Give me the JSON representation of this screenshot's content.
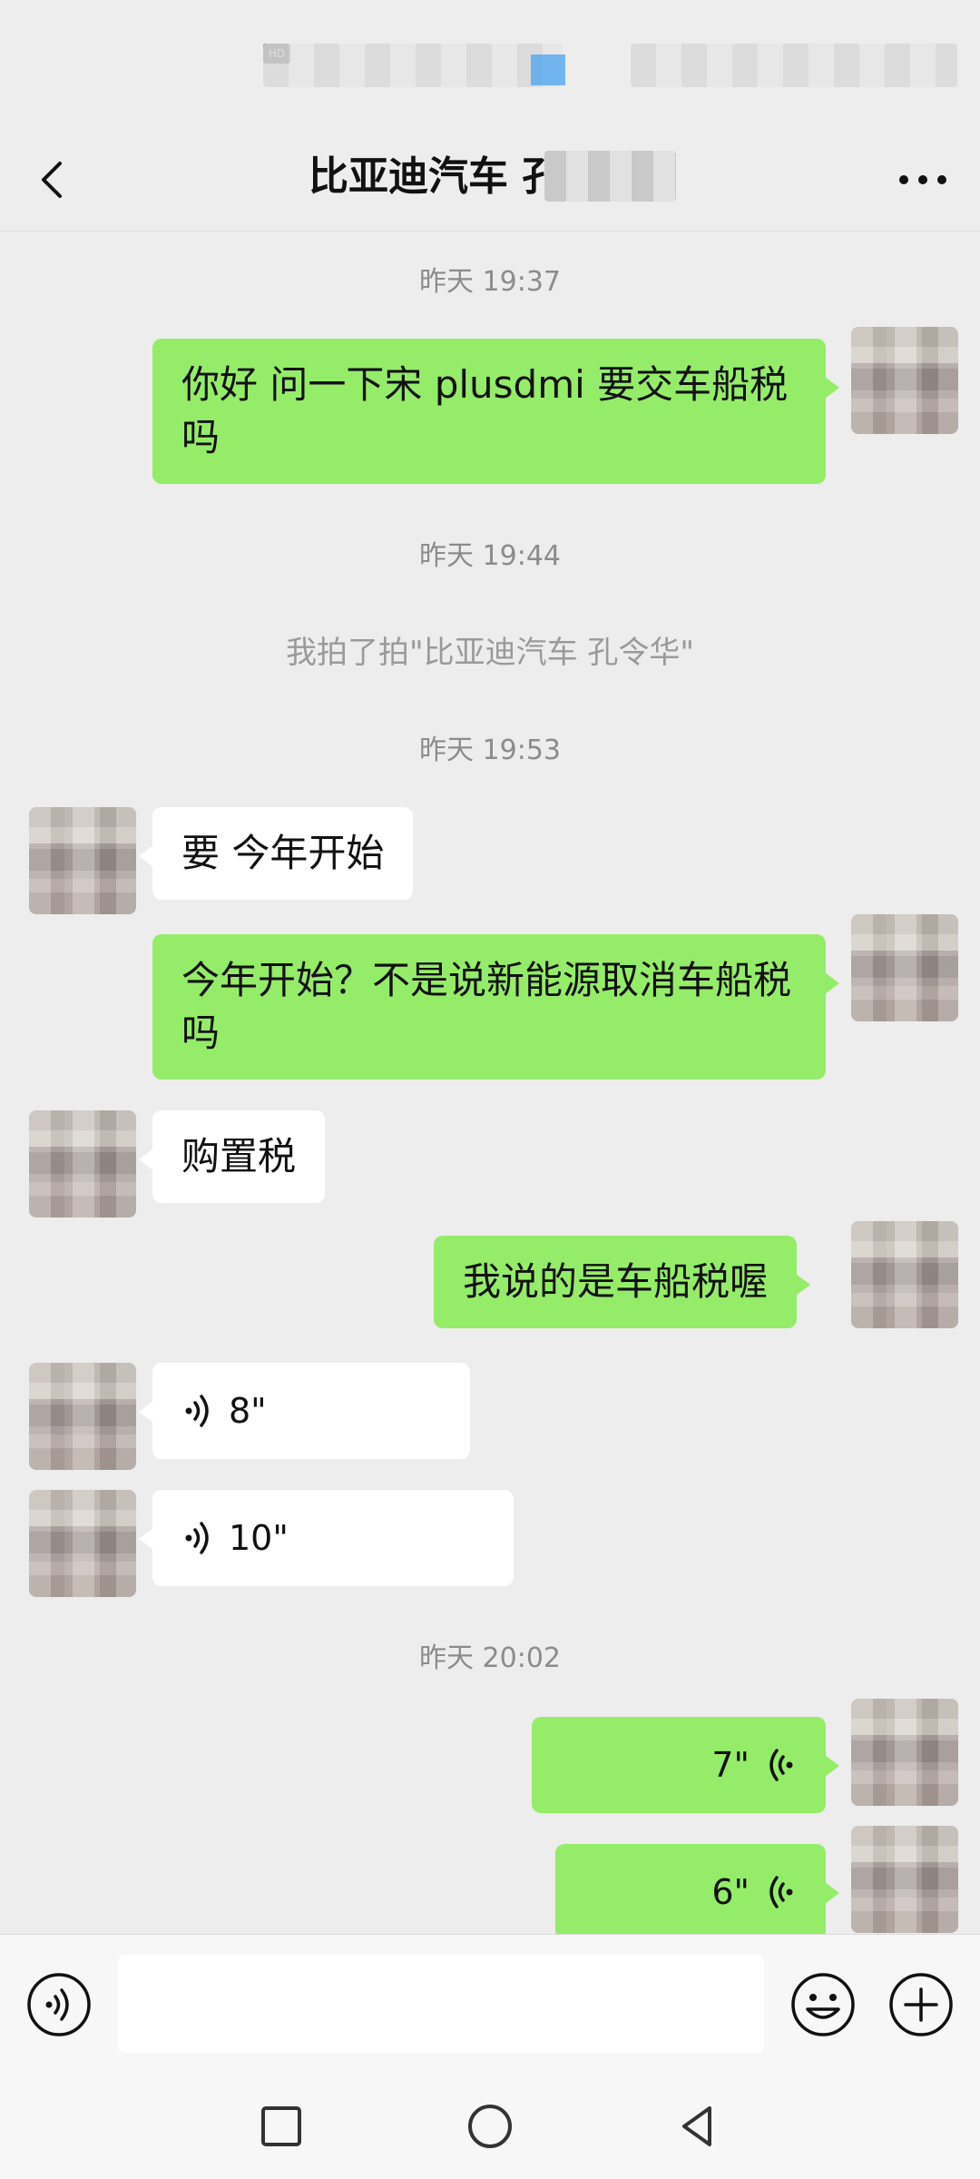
{
  "status_bar": {
    "hd_badge": "HD"
  },
  "header": {
    "title": "比亚迪汽车 孔",
    "back_icon": "chevron-left-icon",
    "more_icon": "more-dots-icon"
  },
  "messages": [
    {
      "type": "time",
      "text": "昨天 19:37"
    },
    {
      "type": "text",
      "side": "right",
      "text": "你好  问一下宋 plusdmi 要交车船税吗"
    },
    {
      "type": "time",
      "text": "昨天 19:44"
    },
    {
      "type": "system",
      "text": "我拍了拍\"比亚迪汽车  孔令华\""
    },
    {
      "type": "time",
      "text": "昨天 19:53"
    },
    {
      "type": "text",
      "side": "left",
      "text": "要 今年开始"
    },
    {
      "type": "text",
      "side": "right",
      "text": "今年开始？不是说新能源取消车船税吗"
    },
    {
      "type": "text",
      "side": "left",
      "text": "购置税"
    },
    {
      "type": "text",
      "side": "right",
      "text": "我说的是车船税喔"
    },
    {
      "type": "voice",
      "side": "left",
      "duration": "8\""
    },
    {
      "type": "voice",
      "side": "left",
      "duration": "10\""
    },
    {
      "type": "time",
      "text": "昨天 20:02"
    },
    {
      "type": "voice",
      "side": "right",
      "duration": "7\""
    },
    {
      "type": "voice",
      "side": "right",
      "duration": "6\""
    }
  ],
  "input_bar": {
    "voice_icon": "voice-mode-icon",
    "input_value": "",
    "emoji_icon": "emoji-icon",
    "plus_icon": "plus-icon"
  },
  "system_nav": {
    "recents_icon": "square-icon",
    "home_icon": "circle-icon",
    "back_icon": "triangle-back-icon"
  },
  "colors": {
    "background": "#ededed",
    "bubble_right": "#95ec69",
    "bubble_left": "#ffffff",
    "time_text": "#8c8c8c"
  }
}
